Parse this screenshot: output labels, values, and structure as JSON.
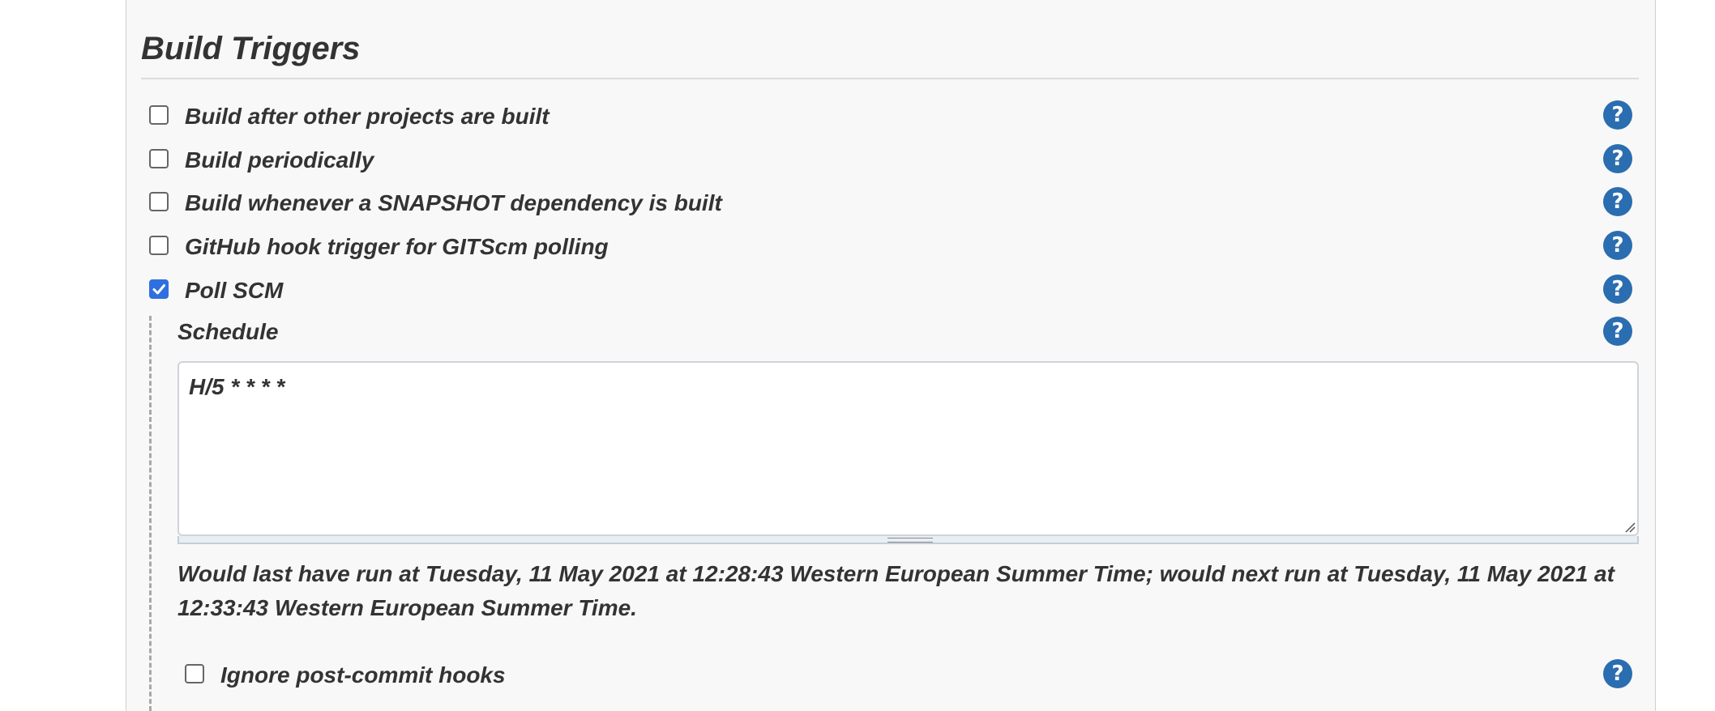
{
  "section": {
    "title": "Build Triggers"
  },
  "triggers": [
    {
      "label": "Build after other projects are built",
      "checked": false
    },
    {
      "label": "Build periodically",
      "checked": false
    },
    {
      "label": "Build whenever a SNAPSHOT dependency is built",
      "checked": false
    },
    {
      "label": "GitHub hook trigger for GITScm polling",
      "checked": false
    },
    {
      "label": "Poll SCM",
      "checked": true
    }
  ],
  "poll_scm": {
    "schedule_label": "Schedule",
    "schedule_value": "H/5 * * * *",
    "schedule_info": "Would last have run at Tuesday, 11 May 2021 at 12:28:43 Western European Summer Time; would next run at Tuesday, 11 May 2021 at 12:33:43 Western European Summer Time.",
    "ignore_hooks_label": "Ignore post-commit hooks",
    "ignore_hooks_checked": false
  },
  "help": {
    "glyph": "?",
    "icon": "help-icon"
  },
  "colors": {
    "accent_checkbox": "#2f6fe0",
    "help_icon": "#2a6db0",
    "panel_bg": "#f8f8f8"
  }
}
